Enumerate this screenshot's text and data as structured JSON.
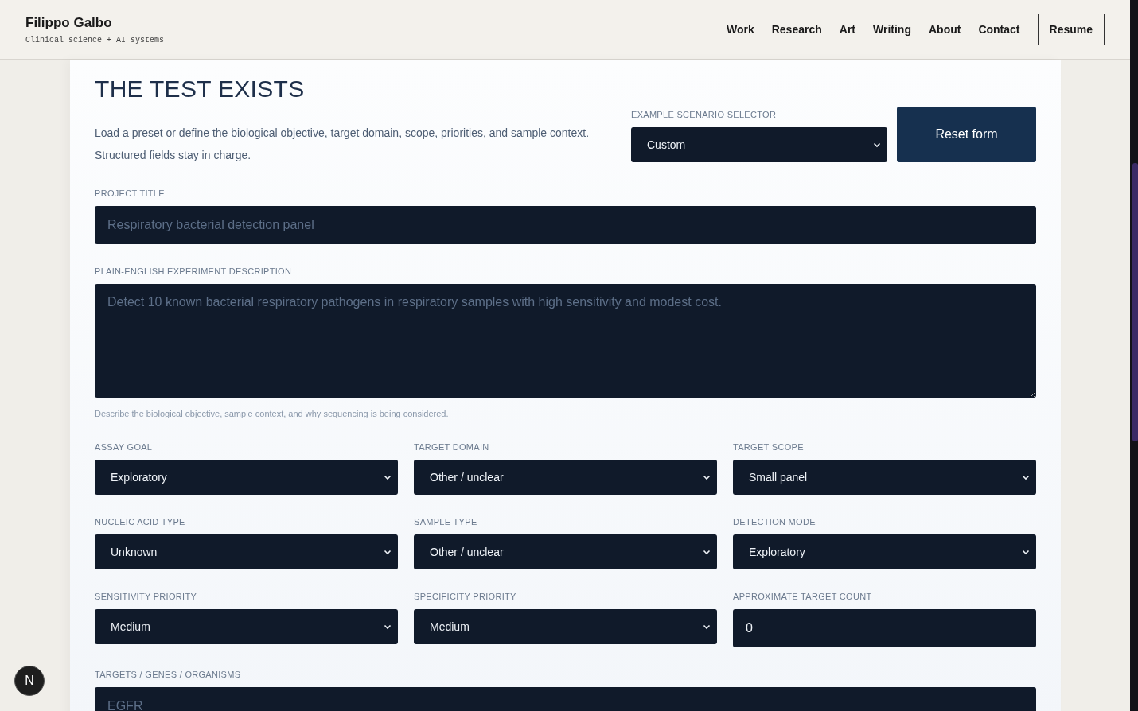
{
  "header": {
    "name": "Filippo Galbo",
    "tagline": "Clinical science + AI systems",
    "nav": [
      "Work",
      "Research",
      "Art",
      "Writing",
      "About",
      "Contact"
    ],
    "resume_button": "Resume"
  },
  "section": {
    "heading": "THE TEST EXISTS",
    "intro": "Load a preset or define the biological objective, target domain, scope, priorities, and sample context. Structured fields stay in charge.",
    "scenario_selector": {
      "label": "EXAMPLE SCENARIO SELECTOR",
      "value": "Custom"
    },
    "reset_button": "Reset form",
    "project_title": {
      "label": "PROJECT TITLE",
      "placeholder": "Respiratory bacterial detection panel"
    },
    "description": {
      "label": "PLAIN-ENGLISH EXPERIMENT DESCRIPTION",
      "placeholder": "Detect 10 known bacterial respiratory pathogens in respiratory samples with high sensitivity and modest cost.",
      "hint": "Describe the biological objective, sample context, and why sequencing is being considered."
    },
    "fields": [
      {
        "label": "ASSAY GOAL",
        "kind": "select",
        "value": "Exploratory"
      },
      {
        "label": "TARGET DOMAIN",
        "kind": "select",
        "value": "Other / unclear"
      },
      {
        "label": "TARGET SCOPE",
        "kind": "select",
        "value": "Small panel"
      },
      {
        "label": "NUCLEIC ACID TYPE",
        "kind": "select",
        "value": "Unknown"
      },
      {
        "label": "SAMPLE TYPE",
        "kind": "select",
        "value": "Other / unclear"
      },
      {
        "label": "DETECTION MODE",
        "kind": "select",
        "value": "Exploratory"
      },
      {
        "label": "SENSITIVITY PRIORITY",
        "kind": "select",
        "value": "Medium"
      },
      {
        "label": "SPECIFICITY PRIORITY",
        "kind": "select",
        "value": "Medium"
      },
      {
        "label": "APPROXIMATE TARGET COUNT",
        "kind": "number",
        "value": "0"
      }
    ],
    "targets": {
      "label": "TARGETS / GENES / ORGANISMS",
      "placeholder": "EGFR"
    }
  },
  "badge": "N"
}
